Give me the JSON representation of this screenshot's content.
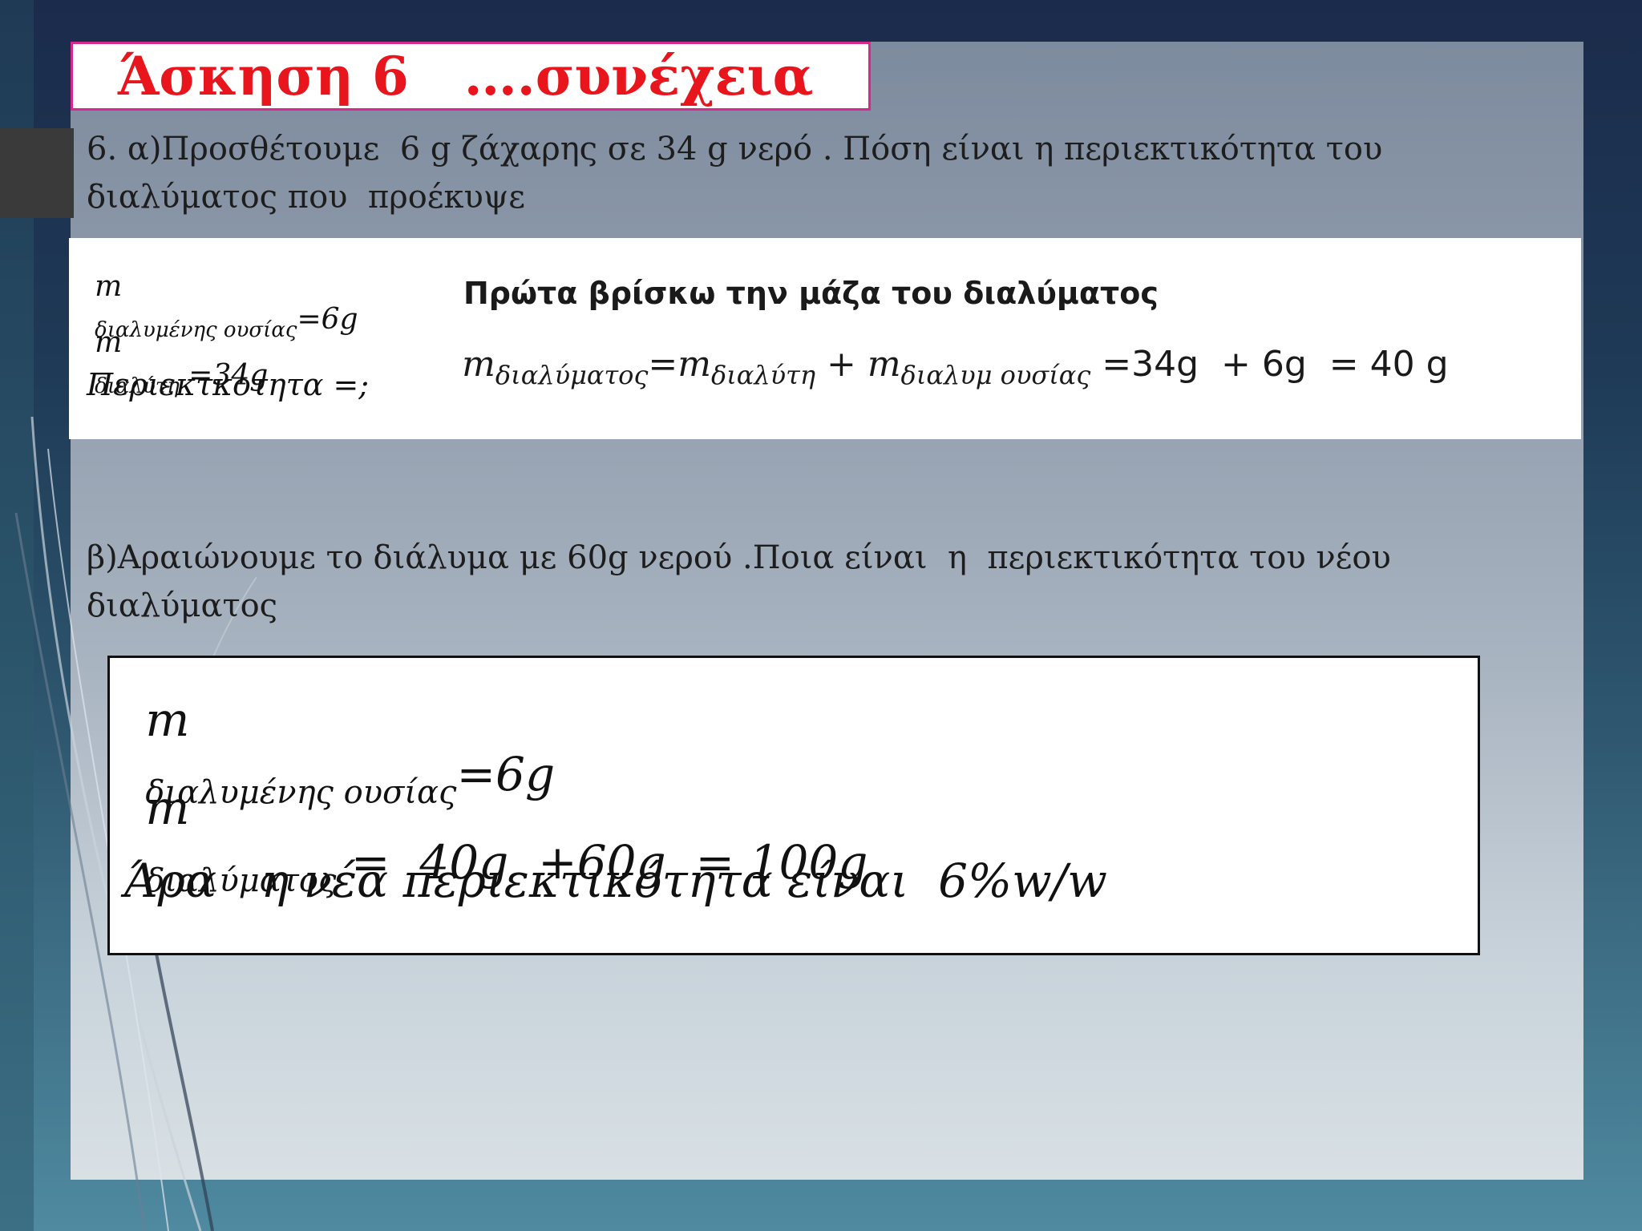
{
  "title": "Άσκηση 6   ….συνέχεια",
  "question_a": "6. α)Προσθέτουμε  6 g ζάχαρης σε 34 g νερό . Πόση είναι η περιεκτικότητα του διαλύματος που  προέκυψε",
  "given": {
    "solute_m": "m",
    "solute_sub": "διαλυμένης ουσίας",
    "solute_val": "=6g",
    "solvent_m": "m",
    "solvent_sub": "διαλύτη",
    "solvent_val": " =34g",
    "unknown": "Περιεκτκοτητα =;"
  },
  "calc": {
    "heading": "Πρώτα βρίσκω την μάζα του διαλύματος",
    "m1": "m",
    "sub1": "διαλύματος",
    "eq1": "=m",
    "sub2": "διαλύτη",
    "plus": " + m",
    "sub3": "διαλυμ ουσίας",
    "result": " =34g  + 6g  = 40 g"
  },
  "question_b": "β)Αραιώνουμε το διάλυμα με 60g νερού .Ποια είναι  η  περιεκτικότητα του νέου διαλύματος",
  "answer": {
    "line1_m": "m",
    "line1_sub": "διαλυμένης ουσίας",
    "line1_val": "=6g",
    "line2_m": "m",
    "line2_sub": "διαλύματος",
    "line2_val": " =  40g  +60g  = 100g",
    "line3": "Άρα   η νέα περιεκτικότητα είναι  6%w/w"
  },
  "colors": {
    "title_text": "#e8161c",
    "title_border": "#d6298f"
  }
}
